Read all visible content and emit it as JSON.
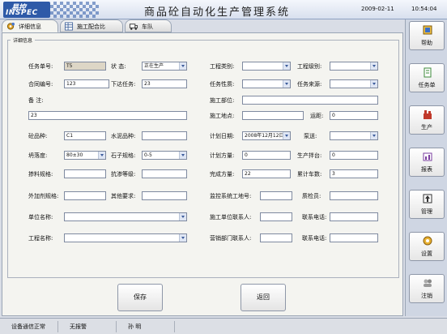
{
  "header": {
    "logo_line1": "易控",
    "logo_line2": "INSPEC",
    "title": "商品砼自动化生产管理系统",
    "date": "2009-02-11",
    "time": "10:54:04"
  },
  "tabs": [
    {
      "label": "详细信息",
      "icon": "gear-icon"
    },
    {
      "label": "施工配合比",
      "icon": "table-icon"
    },
    {
      "label": "车队",
      "icon": "truck-icon"
    }
  ],
  "panel": {
    "legend": "详细信息"
  },
  "form": {
    "task_no": {
      "label": "任务单号:",
      "value": "T5"
    },
    "status": {
      "label": "状    态:",
      "value": "正在生产"
    },
    "project_type": {
      "label": "工程类别:",
      "value": ""
    },
    "project_grade": {
      "label": "工程级别:",
      "value": ""
    },
    "contract_no": {
      "label": "合同编号:",
      "value": "123"
    },
    "issue_task": {
      "label": "下达任务:",
      "value": "23"
    },
    "task_nature": {
      "label": "任务性质:",
      "value": ""
    },
    "task_source": {
      "label": "任务来源:",
      "value": ""
    },
    "remarks": {
      "label": "备    注:",
      "value": "23"
    },
    "construction_part": {
      "label": "施工部位:",
      "value": ""
    },
    "construction_site": {
      "label": "施工地点:",
      "value": ""
    },
    "distance": {
      "label": "运距:",
      "value": "0"
    },
    "concrete_type": {
      "label": "砼品种:",
      "value": "C1"
    },
    "cement_type": {
      "label": "水泥品种:",
      "value": ""
    },
    "plan_date": {
      "label": "计划日期:",
      "value": "2008年12月12日"
    },
    "pump": {
      "label": "泵送:",
      "value": ""
    },
    "slump": {
      "label": "坍落度:",
      "value": "80±30"
    },
    "stone_spec": {
      "label": "石子规格:",
      "value": "0-5"
    },
    "plan_volume": {
      "label": "计划方量:",
      "value": "0"
    },
    "mixer": {
      "label": "生产拌台:",
      "value": "0"
    },
    "admixture_spec": {
      "label": "掺料规格:",
      "value": ""
    },
    "impermeability": {
      "label": "抗渗等级:",
      "value": ""
    },
    "completed_volume": {
      "label": "完成方量:",
      "value": "22"
    },
    "total_trucks": {
      "label": "累计车数:",
      "value": "3"
    },
    "additive_spec": {
      "label": "外加剂规格:",
      "value": ""
    },
    "other_req": {
      "label": "其他要求:",
      "value": ""
    },
    "supervision_phone": {
      "label": "监控系统工地号:",
      "value": ""
    },
    "inspector": {
      "label": "质检员:",
      "value": ""
    },
    "unit_name": {
      "label": "单位名称:",
      "value": ""
    },
    "construction_contact": {
      "label": "施工单位联系人:",
      "value": ""
    },
    "contact_phone1": {
      "label": "联系电话:",
      "value": ""
    },
    "project_name": {
      "label": "工程名称:",
      "value": ""
    },
    "sales_contact": {
      "label": "营销部门联系人:",
      "value": ""
    },
    "contact_phone2": {
      "label": "联系电话:",
      "value": ""
    }
  },
  "actions": {
    "save": "保存",
    "back": "返回"
  },
  "sidebar": [
    {
      "label": "帮助",
      "icon": "help-icon",
      "color": "#3a6fc8"
    },
    {
      "label": "任务单",
      "icon": "task-icon",
      "color": "#3c8a3a"
    },
    {
      "label": "生产",
      "icon": "production-icon",
      "color": "#c0392b"
    },
    {
      "label": "报表",
      "icon": "report-icon",
      "color": "#7b3fa0"
    },
    {
      "label": "管理",
      "icon": "manage-icon",
      "color": "#333333"
    },
    {
      "label": "设置",
      "icon": "settings-icon",
      "color": "#c98a1a"
    },
    {
      "label": "注销",
      "icon": "logout-icon",
      "color": "#888888"
    }
  ],
  "status": {
    "comm": "设备通信正常",
    "alarm": "无报警",
    "user": "孙  明"
  }
}
